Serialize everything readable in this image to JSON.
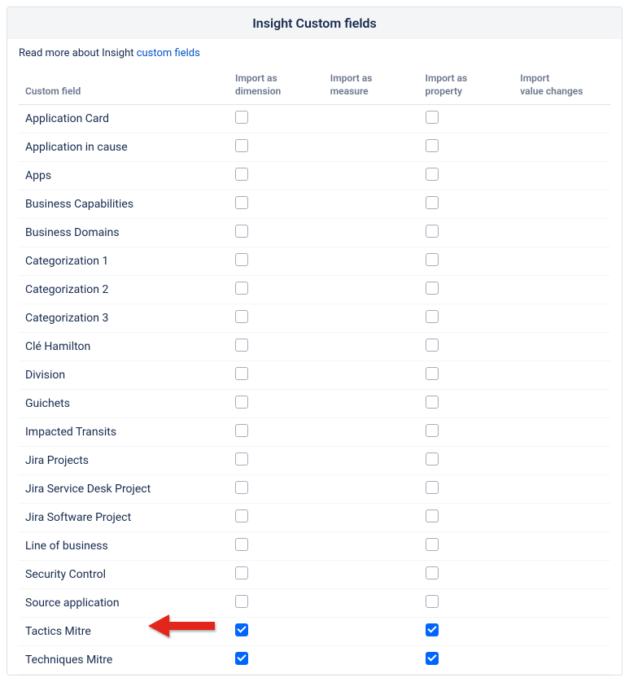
{
  "header": {
    "title": "Insight Custom fields"
  },
  "intro": {
    "prefix": "Read more about Insight ",
    "link_text": "custom fields"
  },
  "columns": {
    "custom_field": "Custom field",
    "dimension_l1": "Import as",
    "dimension_l2": "dimension",
    "measure_l1": "Import as",
    "measure_l2": "measure",
    "property_l1": "Import as",
    "property_l2": "property",
    "changes_l1": "Import",
    "changes_l2": "value changes"
  },
  "rows": [
    {
      "name": "Application Card",
      "dimension": false,
      "measure": null,
      "property": false,
      "changes": null
    },
    {
      "name": "Application in cause",
      "dimension": false,
      "measure": null,
      "property": false,
      "changes": null
    },
    {
      "name": "Apps",
      "dimension": false,
      "measure": null,
      "property": false,
      "changes": null
    },
    {
      "name": "Business Capabilities",
      "dimension": false,
      "measure": null,
      "property": false,
      "changes": null
    },
    {
      "name": "Business Domains",
      "dimension": false,
      "measure": null,
      "property": false,
      "changes": null
    },
    {
      "name": "Categorization 1",
      "dimension": false,
      "measure": null,
      "property": false,
      "changes": null
    },
    {
      "name": "Categorization 2",
      "dimension": false,
      "measure": null,
      "property": false,
      "changes": null
    },
    {
      "name": "Categorization 3",
      "dimension": false,
      "measure": null,
      "property": false,
      "changes": null
    },
    {
      "name": "Clé Hamilton",
      "dimension": false,
      "measure": null,
      "property": false,
      "changes": null
    },
    {
      "name": "Division",
      "dimension": false,
      "measure": null,
      "property": false,
      "changes": null
    },
    {
      "name": "Guichets",
      "dimension": false,
      "measure": null,
      "property": false,
      "changes": null
    },
    {
      "name": "Impacted Transits",
      "dimension": false,
      "measure": null,
      "property": false,
      "changes": null
    },
    {
      "name": "Jira Projects",
      "dimension": false,
      "measure": null,
      "property": false,
      "changes": null
    },
    {
      "name": "Jira Service Desk Project",
      "dimension": false,
      "measure": null,
      "property": false,
      "changes": null
    },
    {
      "name": "Jira Software Project",
      "dimension": false,
      "measure": null,
      "property": false,
      "changes": null
    },
    {
      "name": "Line of business",
      "dimension": false,
      "measure": null,
      "property": false,
      "changes": null
    },
    {
      "name": "Security Control",
      "dimension": false,
      "measure": null,
      "property": false,
      "changes": null
    },
    {
      "name": "Source application",
      "dimension": false,
      "measure": null,
      "property": false,
      "changes": null
    },
    {
      "name": "Tactics Mitre",
      "dimension": true,
      "measure": null,
      "property": true,
      "changes": null,
      "arrow": true
    },
    {
      "name": "Techniques Mitre",
      "dimension": true,
      "measure": null,
      "property": true,
      "changes": null
    }
  ]
}
